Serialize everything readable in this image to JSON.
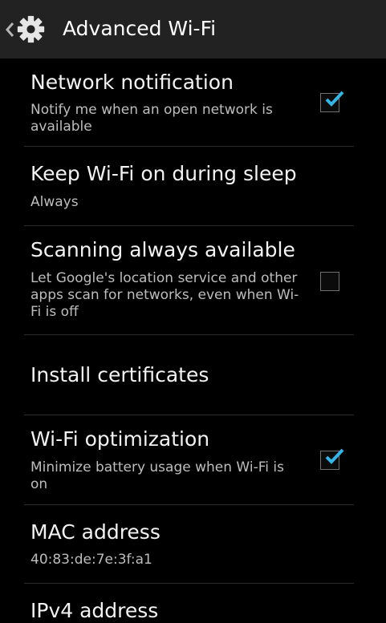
{
  "action_bar": {
    "title": "Advanced Wi-Fi",
    "back_icon": "chevron-left-icon",
    "app_icon": "gear-icon"
  },
  "settings": {
    "network_notification": {
      "title": "Network notification",
      "summary": "Notify me when an open network is available",
      "checked": true
    },
    "keep_wifi_on": {
      "title": "Keep Wi-Fi on during sleep",
      "summary": "Always"
    },
    "scanning_always_available": {
      "title": "Scanning always available",
      "summary": "Let Google's location service and other apps scan for networks, even when Wi-Fi is off",
      "checked": false
    },
    "install_certificates": {
      "title": "Install certificates"
    },
    "wifi_optimization": {
      "title": "Wi-Fi optimization",
      "summary": "Minimize battery usage when Wi-Fi is on",
      "checked": true
    },
    "mac_address": {
      "title": "MAC address",
      "value": "40:83:de:7e:3f:a1"
    },
    "ipv4_address": {
      "title": "IPv4 address"
    }
  },
  "colors": {
    "background": "#000000",
    "action_bar": "#222222",
    "check_accent": "#33b5e5",
    "primary_text": "#f2f2f2",
    "secondary_text": "#bdbdbd"
  }
}
